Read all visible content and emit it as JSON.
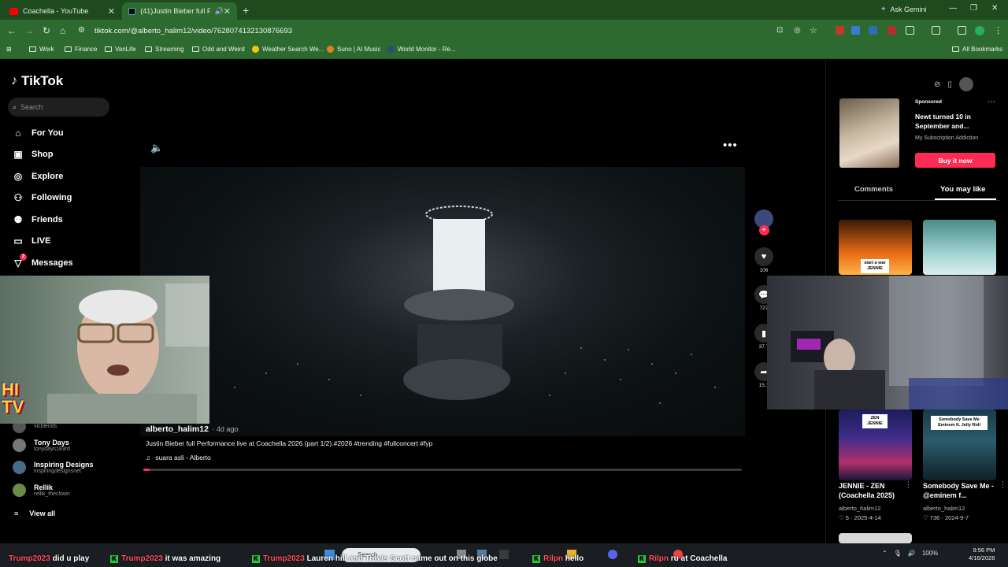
{
  "browser": {
    "tabs": [
      {
        "title": "Coachella - YouTube",
        "icon": "youtube-icon",
        "color": "#ff0000"
      },
      {
        "title": "(41)Justin Bieber full Perfor",
        "icon": "tiktok-icon",
        "color": "#000000"
      }
    ],
    "new_tab": "+",
    "ask_gemini": "Ask Gemini",
    "url": "tiktok.com/@alberto_halim12/video/7628074132130876693",
    "bookmarks": [
      "Work",
      "Finance",
      "VanLife",
      "Streaming",
      "Odd and Weird",
      "Weather Search We...",
      "Suno | AI Music",
      "World Monitor - Re..."
    ],
    "all_bookmarks": "All Bookmarks",
    "theme_color": "#2d6a2f"
  },
  "tiktok": {
    "logo": "TikTok",
    "search_placeholder": "Search",
    "nav": [
      {
        "label": "For You",
        "icon": "home-icon"
      },
      {
        "label": "Shop",
        "icon": "shop-icon"
      },
      {
        "label": "Explore",
        "icon": "compass-icon"
      },
      {
        "label": "Following",
        "icon": "following-icon"
      },
      {
        "label": "Friends",
        "icon": "friends-icon"
      },
      {
        "label": "LIVE",
        "icon": "live-icon"
      },
      {
        "label": "Messages",
        "icon": "messages-icon",
        "badge": "2"
      }
    ],
    "following": [
      {
        "name": "",
        "handle": "vicblends"
      },
      {
        "name": "Tony Days",
        "handle": "tonydays183rd"
      },
      {
        "name": "Inspiring Designs",
        "handle": "inspiringdesignsnet"
      },
      {
        "name": "Rellik",
        "handle": "rellik_theclown"
      }
    ],
    "view_all": "View all",
    "video": {
      "username": "alberto_halim12",
      "age": "· 4d ago",
      "description": "Justin Bieber full Performance live at Coachella 2026 (part 1/2).#2026 #trending #fullconcert #fyp",
      "music": "suara asli - Alberto",
      "progress": 0.01,
      "likes": "106",
      "comments": "727",
      "saves": "37.7",
      "shares": "15.1"
    },
    "ad": {
      "sponsored": "Sponsored",
      "title": "Newt turned 10 in September and...",
      "brand": "My Subscription Addiction",
      "button": "Buy it now"
    },
    "tabs": {
      "comments": "Comments",
      "you_may_like": "You may like"
    },
    "recommendations": [
      {
        "overlay": "start a war JENNIE",
        "title": "",
        "user": "",
        "meta": ""
      },
      {
        "overlay": "",
        "title": "",
        "user": "",
        "meta": ""
      },
      {
        "overlay": "ZEN JENNIE",
        "title": "JENNIE - ZEN (Coachella 2025)",
        "user": "alberto_halim12",
        "meta": "♡ 5 · 2025-4-14"
      },
      {
        "overlay": "Somebody Save Me Eminem ft. Jelly Roll",
        "title": "Somebody Save Me - @eminem f...",
        "user": "alberto_halim12",
        "meta": "♡ 736 · 2024-9-7"
      }
    ],
    "accent": "#fe2c55"
  },
  "stream_overlay": {
    "logo": "HI TV",
    "chat": [
      {
        "user": "Trump2023",
        "message": "did u play"
      },
      {
        "user": "Trump2023",
        "message": "it was amazing"
      },
      {
        "user": "Trump2023",
        "message": "Lauren hill and Travis Scott came out on this globe"
      },
      {
        "user": "Rilpn",
        "message": "hello"
      },
      {
        "user": "Rilpn",
        "message": "ru at Coachella"
      }
    ]
  },
  "taskbar": {
    "search": "Search",
    "battery": "100%",
    "time": "9:56 PM",
    "date": "4/16/2026"
  }
}
